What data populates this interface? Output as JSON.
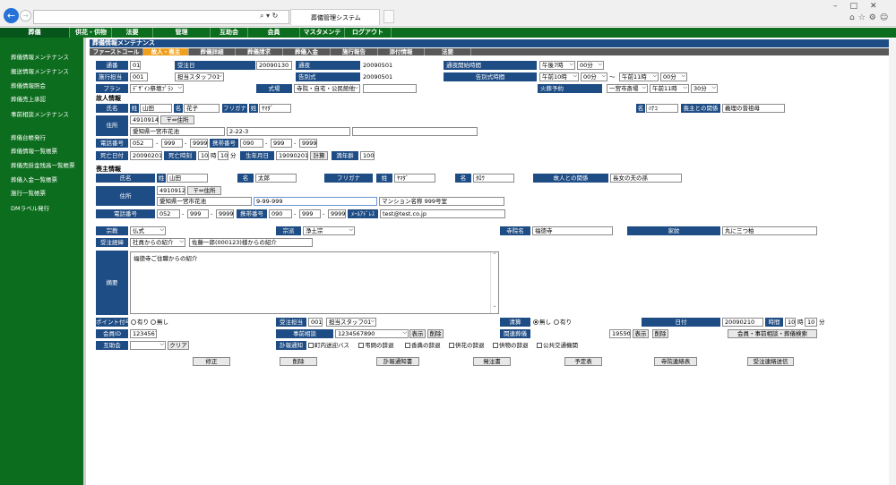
{
  "browser": {
    "tab_title": "葬儀管理システム",
    "address": "",
    "nav_controls": "⌕ ▾ ↻"
  },
  "nav": [
    "葬儀",
    "供花・供物",
    "法要",
    "管理",
    "互助会",
    "会員",
    "マスタメンテ",
    "ログアウト"
  ],
  "sidebar": [
    "葬儀情報メンテナンス",
    "搬送情報メンテナンス",
    "葬儀情報照会",
    "葬儀売上承認",
    "事前相談メンテナンス",
    "葬儀台帳発行",
    "葬儀情報一覧帳票",
    "葬儀売掛金残高一覧帳票",
    "葬儀入金一覧帳票",
    "施行一覧帳票",
    "DMラベル発行"
  ],
  "title": "葬儀情報メンテナンス",
  "subtabs": [
    "ファーストコール",
    "故人・喪主",
    "葬儀詳細",
    "葬儀請求",
    "葬儀入金",
    "施行報告",
    "添付情報",
    "法要"
  ],
  "row1": {
    "l_no": "通番",
    "no": "01",
    "l_uketsuke": "受注日",
    "uketsuke": "20090130",
    "l_tsuya": "通夜",
    "tsuya": "20090501",
    "l_tsuyajikan": "通夜開始時間",
    "tsuya_time": "午後7時",
    "tsuya_min": "00分"
  },
  "row2": {
    "l_seko": "施行担当",
    "seko": "001",
    "seko_name": "担当スタッフ01",
    "l_kokubetsu": "告別式",
    "kokubetsu": "20090501",
    "l_kokujikan": "告別式時間",
    "k_from": "午前10時",
    "k_from_min": "00分",
    "tilde": "〜",
    "k_to": "午前11時",
    "k_to_min": "00分"
  },
  "row3": {
    "l_plan": "プラン",
    "plan": "ﾃﾞｻﾞｲﾝ祭壇ﾌﾟﾗﾝ",
    "l_shikijo": "式場",
    "shikijo": "寺院・自宅・公民館他",
    "l_kaso": "火葬予約",
    "kaso_place": "一宮市斎場",
    "kaso_time": "午前11時",
    "kaso_min": "30分"
  },
  "kojin": {
    "header": "故人情報",
    "l_name": "氏名",
    "sei_l": "姓",
    "sei": "山田",
    "mei_l": "名",
    "mei": "花子",
    "l_kana": "フリガナ",
    "kana_sei_l": "姓",
    "kana_sei": "ﾔﾏﾀﾞ",
    "kana_mei_l": "名",
    "kana_mei": "ﾊﾅｺ",
    "l_rel": "喪主との関係",
    "rel": "義理の曾祖母",
    "l_addr": "住所",
    "zip": "4910914",
    "zip_btn": "〒⇔住所",
    "addr1": "愛知県一宮市花池",
    "addr2": "2-22-3",
    "addr3": "",
    "l_tel": "電話番号",
    "tel1": "052",
    "tel2": "999",
    "tel3": "9999",
    "dash": "-",
    "l_mobile": "携帯番号",
    "m1": "090",
    "m2": "999",
    "m3": "9999",
    "l_death": "死亡日付",
    "death": "20090201",
    "l_dtime": "死亡時刻",
    "dh": "10",
    "dh_u": "時",
    "dm": "10",
    "dm_u": "分",
    "l_birth": "生年月日",
    "birth": "19090201",
    "calc": "計算",
    "l_age": "満年齢",
    "age": "100"
  },
  "moshu": {
    "header": "喪主情報",
    "l_name": "氏名",
    "sei_l": "姓",
    "sei": "山田",
    "mei_l": "名",
    "mei": "太郎",
    "l_kana": "フリガナ",
    "kana_sei_l": "姓",
    "kana_sei": "ﾔﾏﾀﾞ",
    "kana_mei_l": "名",
    "kana_mei": "ﾀﾛｳ",
    "l_rel": "故人との関係",
    "rel": "長女の夫の孫",
    "l_addr": "住所",
    "zip": "4910912",
    "zip_btn": "〒⇔住所",
    "addr1": "愛知県一宮市花池",
    "addr2": "9-99-999",
    "addr3": "マンション名称 999号室",
    "l_tel": "電話番号",
    "tel1": "052",
    "tel2": "999",
    "tel3": "9999",
    "l_mobile": "携帯番号",
    "m1": "090",
    "m2": "999",
    "m3": "9999",
    "l_mail": "ﾒｰﾙｱﾄﾞﾚｽ",
    "mail": "test@test.co.jp"
  },
  "misc": {
    "l_shukyo": "宗教",
    "shukyo": "仏式",
    "l_shuha": "宗派",
    "shuha": "浄土宗",
    "l_jiin": "寺院名",
    "jiin": "福徳寺",
    "l_kamon": "家紋",
    "kamon": "丸に三つ柏",
    "l_keii": "受注経緯",
    "keii": "社員からの紹介",
    "keii_note": "佐藤一郎(000123)様からの紹介",
    "l_memo": "摘要",
    "memo": "福徳寺ご住職からの紹介",
    "l_point": "ポイント付与",
    "p_yes": "有り",
    "p_no": "無し",
    "l_uketan": "受注担当",
    "uketan": "001",
    "uketan_name": "担当スタッフ01",
    "l_seisan": "清算",
    "s_no": "無し",
    "s_yes": "有り",
    "l_date": "日付",
    "date": "20090210",
    "l_time": "時間",
    "th": "10",
    "th_u": "時",
    "tm": "10",
    "tm_u": "分",
    "l_kaiin": "会員ID",
    "kaiin": "1234567",
    "l_jizen": "事前相談",
    "jizen": "1234567890",
    "show": "表示",
    "del": "削除",
    "l_kanren": "関連葬儀",
    "kanren": "1955030103",
    "search_btn": "会員・事前相談・葬儀検索",
    "l_gojo": "互助会",
    "clear": "クリア",
    "l_keihou": "訃報通知",
    "checks": [
      "町内送迎バス",
      "弔問の辞退",
      "香典の辞退",
      "供花の辞退",
      "供物の辞退",
      "公共交通機関"
    ]
  },
  "buttons": [
    "修正",
    "削除",
    "訃報通知書",
    "発注書",
    "予定表",
    "寺院連絡表",
    "受注連絡送信"
  ]
}
